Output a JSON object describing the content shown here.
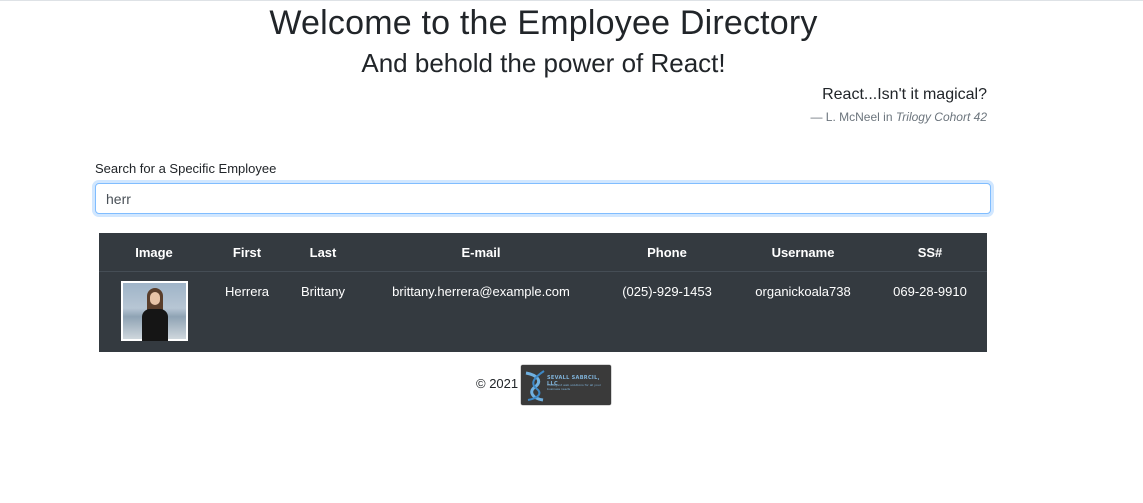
{
  "header": {
    "title": "Welcome to the Employee Directory",
    "subtitle": "And behold the power of React!"
  },
  "quote": {
    "text": "React...Isn't it magical?",
    "author": "— L. McNeel in",
    "source": "Trilogy Cohort 42"
  },
  "search": {
    "label": "Search for a Specific Employee",
    "value": "herr"
  },
  "table": {
    "columns": [
      "Image",
      "First",
      "Last",
      "E-mail",
      "Phone",
      "Username",
      "SS#"
    ],
    "rows": [
      {
        "image": "employee-photo",
        "first": "Herrera",
        "last": "Brittany",
        "email": "brittany.herrera@example.com",
        "phone": "(025)-929-1453",
        "username": "organickoala738",
        "ssn": "069-28-9910"
      }
    ]
  },
  "footer": {
    "copyright": "© 2021",
    "logo_icon": "company-logo",
    "logo_title": "SEVALL SABRCIL, LLC",
    "logo_tagline": "Intelligent web solutions for all your business needs"
  },
  "colors": {
    "table_bg": "#343a40",
    "focus_border": "#80bdff",
    "text": "#212529",
    "muted": "#6c757d"
  }
}
